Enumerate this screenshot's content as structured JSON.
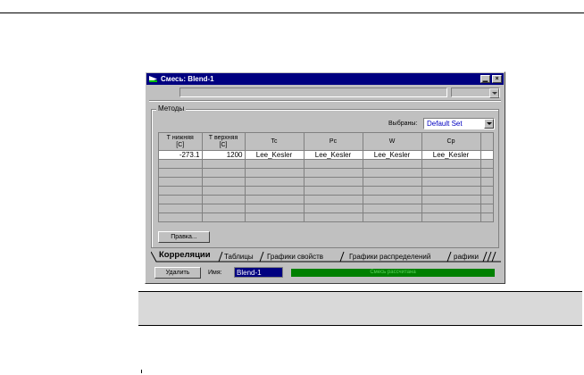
{
  "window": {
    "title": "Смесь: Blend-1",
    "controls": {
      "minimize": "▁",
      "close": "×"
    }
  },
  "methods_group": {
    "label": "Методы",
    "selected_label": "Выбраны:",
    "selected_value": "Default Set"
  },
  "table": {
    "headers": [
      {
        "line1": "Т нижняя",
        "line2": "[C]"
      },
      {
        "line1": "Т верхняя",
        "line2": "[C]"
      },
      {
        "line1": "Tc",
        "line2": ""
      },
      {
        "line1": "Pc",
        "line2": ""
      },
      {
        "line1": "W",
        "line2": ""
      },
      {
        "line1": "Cp",
        "line2": ""
      }
    ],
    "rows": [
      [
        "-273.1",
        "1200",
        "Lee_Kesler",
        "Lee_Kesler",
        "Lee_Kesler",
        "Lee_Kesler"
      ]
    ]
  },
  "buttons": {
    "edit": "Правка...",
    "delete": "Удалить"
  },
  "tabs": [
    "Корреляции",
    "Таблицы",
    "Графики свойств",
    "Графики распределений",
    "рафики"
  ],
  "footer": {
    "name_label": "Имя:",
    "name_value": "Blend-1",
    "status": "Смесь рассчитана"
  }
}
